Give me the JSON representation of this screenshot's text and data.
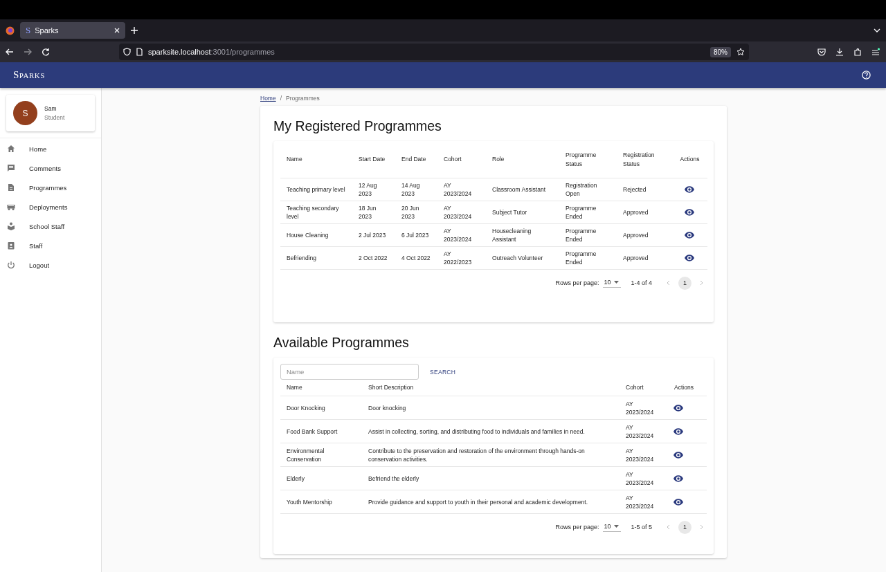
{
  "browser": {
    "tab_title": "Sparks",
    "tab_favicon": "S",
    "url_host": "sparksite.localhost",
    "url_path": ":3001/programmes",
    "zoom": "80%"
  },
  "app_bar": {
    "title": "Sparks"
  },
  "user": {
    "initial": "S",
    "name": "Sam",
    "role": "Student"
  },
  "sidebar": {
    "items": [
      {
        "label": "Home"
      },
      {
        "label": "Comments"
      },
      {
        "label": "Programmes"
      },
      {
        "label": "Deployments"
      },
      {
        "label": "School Staff"
      },
      {
        "label": "Staff"
      },
      {
        "label": "Logout"
      }
    ]
  },
  "breadcrumb": {
    "links": [
      "Home"
    ],
    "current": "Programmes",
    "separator": "/"
  },
  "registered": {
    "title": "My Registered Programmes",
    "table": {
      "columns": [
        "Name",
        "Start Date",
        "End Date",
        "Cohort",
        "Role",
        "Programme Status",
        "Registration Status",
        "Actions"
      ],
      "rows": [
        [
          "Teaching primary level",
          "12 Aug 2023",
          "14 Aug 2023",
          "AY 2023/2024",
          "Classroom Assistant",
          "Registration Open",
          "Rejected"
        ],
        [
          "Teaching secondary level",
          "18 Jun 2023",
          "20 Jun 2023",
          "AY 2023/2024",
          "Subject Tutor",
          "Programme Ended",
          "Approved"
        ],
        [
          "House Cleaning",
          "2 Jul 2023",
          "6 Jul 2023",
          "AY 2023/2024",
          "Housecleaning Assistant",
          "Programme Ended",
          "Approved"
        ],
        [
          "Befriending",
          "2 Oct 2022",
          "4 Oct 2022",
          "AY 2022/2023",
          "Outreach Volunteer",
          "Programme Ended",
          "Approved"
        ]
      ]
    },
    "pagination": {
      "label": "Rows per page:",
      "rows_per_page": "10",
      "range": "1-4 of 4",
      "page": "1"
    }
  },
  "available": {
    "title": "Available Programmes",
    "search": {
      "placeholder": "Name",
      "button": "SEARCH"
    },
    "table": {
      "columns": [
        "Name",
        "Short Description",
        "Cohort",
        "Actions"
      ],
      "rows": [
        [
          "Door Knocking",
          "Door knocking",
          "AY 2023/2024"
        ],
        [
          "Food Bank Support",
          "Assist in collecting, sorting, and distributing food to individuals and families in need.",
          "AY 2023/2024"
        ],
        [
          "Environmental Conservation",
          "Contribute to the preservation and restoration of the environment through hands-on conservation activities.",
          "AY 2023/2024"
        ],
        [
          "Elderly",
          "Befriend the elderly",
          "AY 2023/2024"
        ],
        [
          "Youth Mentorship",
          "Provide guidance and support to youth in their personal and academic development.",
          "AY 2023/2024"
        ]
      ]
    },
    "pagination": {
      "label": "Rows per page:",
      "rows_per_page": "10",
      "range": "1-5 of 5",
      "page": "1"
    }
  }
}
